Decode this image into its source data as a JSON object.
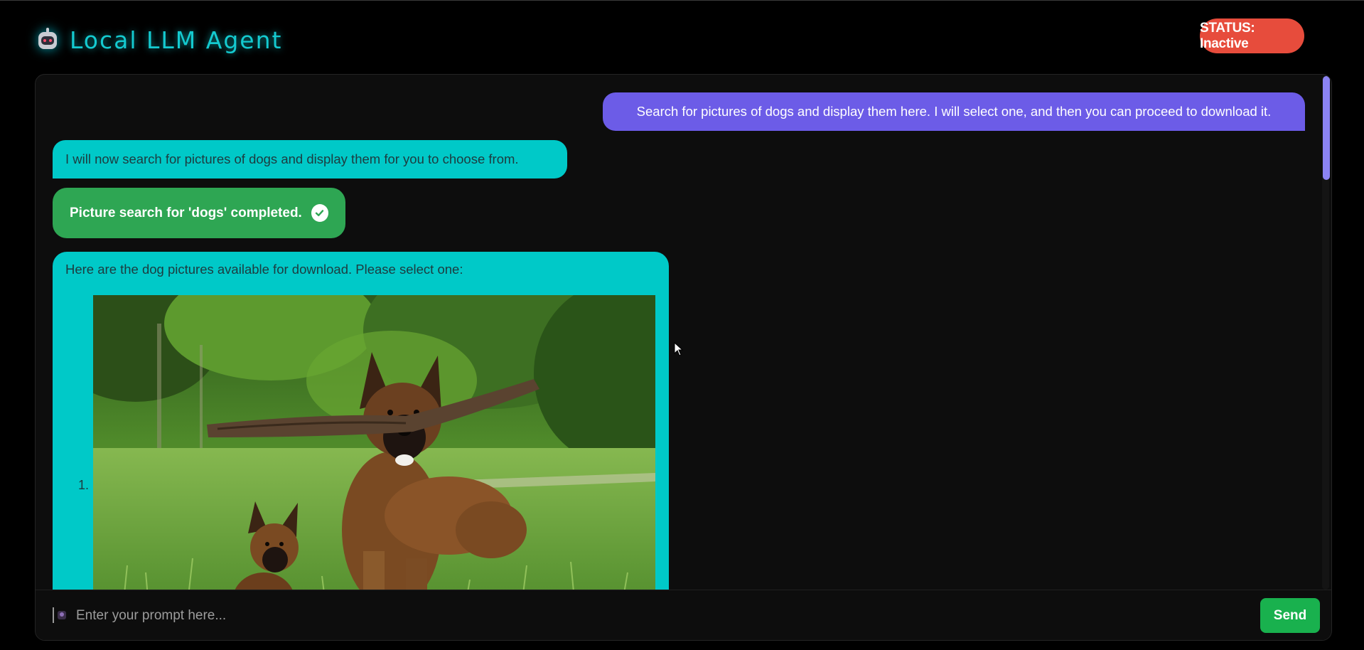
{
  "app": {
    "title": "Local LLM Agent",
    "logo_icon": "robot-icon"
  },
  "status": {
    "label": "STATUS: Inactive",
    "color": "#e74c3c"
  },
  "messages": {
    "user_request": "Search for pictures of dogs and display them here. I will select one, and then you can proceed to download it.",
    "agent_reply": "I will now search for pictures of dogs and display them for you to choose from.",
    "tool_result": "Picture search for 'dogs' completed.",
    "tool_icon": "check-circle-icon",
    "gallery_intro": "Here are the dog pictures available for download. Please select one:",
    "gallery_items": [
      {
        "number": "1.",
        "image": "German shepherd dog and puppy with stick on grass"
      }
    ]
  },
  "input": {
    "placeholder": "Enter your prompt here...",
    "value": "",
    "send_label": "Send"
  },
  "colors": {
    "accent": "#14cad0",
    "user_bubble": "#6c5ce7",
    "agent_bubble": "#00c9c8",
    "tool_bubble": "#2ea653",
    "send_button": "#19b14e",
    "scrollbar": "#8b83f2"
  }
}
